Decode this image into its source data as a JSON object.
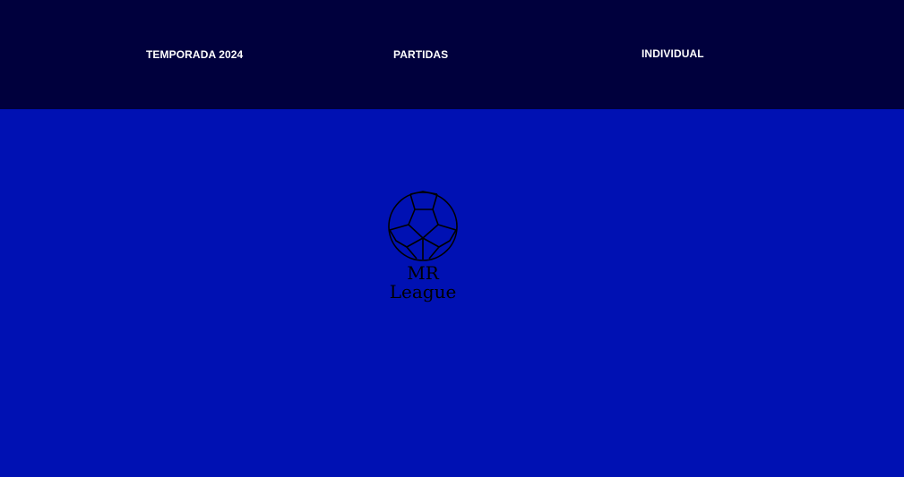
{
  "colors": {
    "header_bg": "#00003d",
    "page_bg": "#0011b3",
    "nav_text": "#ffffff",
    "logo_ink": "#000000"
  },
  "nav": {
    "items": [
      {
        "label": "TEMPORADA 2024"
      },
      {
        "label": "PARTIDAS"
      },
      {
        "label": "INDIVIDUAL"
      }
    ]
  },
  "logo": {
    "icon": "soccer-ball-icon",
    "line1": "MR",
    "line2": "League"
  }
}
